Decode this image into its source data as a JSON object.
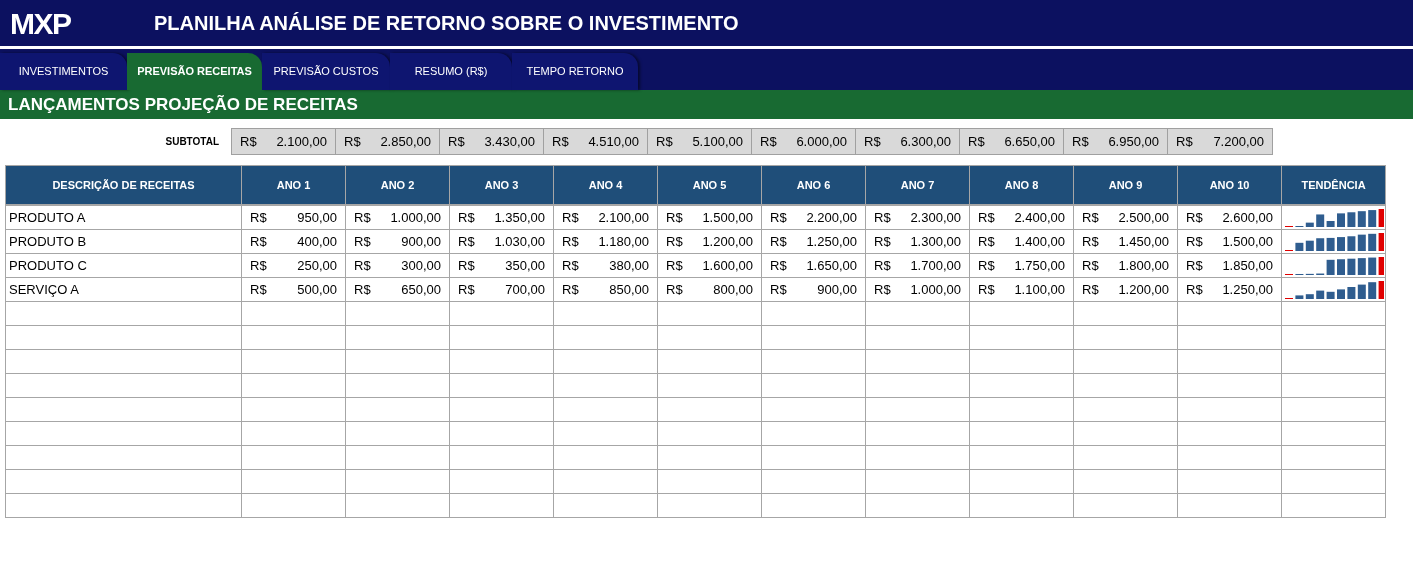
{
  "header": {
    "logo": "MXP",
    "title": "PLANILHA ANÁLISE DE RETORNO SOBRE O INVESTIMENTO"
  },
  "tabs": [
    {
      "label": "INVESTIMENTOS",
      "selected": false
    },
    {
      "label": "PREVISÃO RECEITAS",
      "selected": true
    },
    {
      "label": "PREVISÃO CUSTOS",
      "selected": false
    },
    {
      "label": "RESUMO (R$)",
      "selected": false
    },
    {
      "label": "TEMPO RETORNO",
      "selected": false
    }
  ],
  "section_title": "LANÇAMENTOS PROJEÇÃO DE RECEITAS",
  "subtotal": {
    "label": "SUBTOTAL",
    "values": [
      {
        "currency": "R$",
        "amount": "2.100,00"
      },
      {
        "currency": "R$",
        "amount": "2.850,00"
      },
      {
        "currency": "R$",
        "amount": "3.430,00"
      },
      {
        "currency": "R$",
        "amount": "4.510,00"
      },
      {
        "currency": "R$",
        "amount": "5.100,00"
      },
      {
        "currency": "R$",
        "amount": "6.000,00"
      },
      {
        "currency": "R$",
        "amount": "6.300,00"
      },
      {
        "currency": "R$",
        "amount": "6.650,00"
      },
      {
        "currency": "R$",
        "amount": "6.950,00"
      },
      {
        "currency": "R$",
        "amount": "7.200,00"
      }
    ]
  },
  "table": {
    "columns": [
      "DESCRIÇÃO DE RECEITAS",
      "ANO 1",
      "ANO 2",
      "ANO 3",
      "ANO 4",
      "ANO 5",
      "ANO 6",
      "ANO 7",
      "ANO 8",
      "ANO 9",
      "ANO 10",
      "TENDÊNCIA"
    ],
    "rows": [
      {
        "cells": [
          {
            "kind": "text",
            "text": "PRODUTO A"
          },
          {
            "kind": "money",
            "currency": "R$",
            "amount": "950,00"
          },
          {
            "kind": "money",
            "currency": "R$",
            "amount": "1.000,00"
          },
          {
            "kind": "money",
            "currency": "R$",
            "amount": "1.350,00"
          },
          {
            "kind": "money",
            "currency": "R$",
            "amount": "2.100,00"
          },
          {
            "kind": "money",
            "currency": "R$",
            "amount": "1.500,00"
          },
          {
            "kind": "money",
            "currency": "R$",
            "amount": "2.200,00"
          },
          {
            "kind": "money",
            "currency": "R$",
            "amount": "2.300,00"
          },
          {
            "kind": "money",
            "currency": "R$",
            "amount": "2.400,00"
          },
          {
            "kind": "money",
            "currency": "R$",
            "amount": "2.500,00"
          },
          {
            "kind": "money",
            "currency": "R$",
            "amount": "2.600,00"
          },
          {
            "kind": "sparkline"
          }
        ]
      },
      {
        "cells": [
          {
            "kind": "text",
            "text": "PRODUTO B"
          },
          {
            "kind": "money",
            "currency": "R$",
            "amount": "400,00"
          },
          {
            "kind": "money",
            "currency": "R$",
            "amount": "900,00"
          },
          {
            "kind": "money",
            "currency": "R$",
            "amount": "1.030,00"
          },
          {
            "kind": "money",
            "currency": "R$",
            "amount": "1.180,00"
          },
          {
            "kind": "money",
            "currency": "R$",
            "amount": "1.200,00"
          },
          {
            "kind": "money",
            "currency": "R$",
            "amount": "1.250,00"
          },
          {
            "kind": "money",
            "currency": "R$",
            "amount": "1.300,00"
          },
          {
            "kind": "money",
            "currency": "R$",
            "amount": "1.400,00"
          },
          {
            "kind": "money",
            "currency": "R$",
            "amount": "1.450,00"
          },
          {
            "kind": "money",
            "currency": "R$",
            "amount": "1.500,00"
          },
          {
            "kind": "sparkline"
          }
        ]
      },
      {
        "cells": [
          {
            "kind": "text",
            "text": "PRODUTO C"
          },
          {
            "kind": "money",
            "currency": "R$",
            "amount": "250,00"
          },
          {
            "kind": "money",
            "currency": "R$",
            "amount": "300,00"
          },
          {
            "kind": "money",
            "currency": "R$",
            "amount": "350,00"
          },
          {
            "kind": "money",
            "currency": "R$",
            "amount": "380,00"
          },
          {
            "kind": "money",
            "currency": "R$",
            "amount": "1.600,00"
          },
          {
            "kind": "money",
            "currency": "R$",
            "amount": "1.650,00"
          },
          {
            "kind": "money",
            "currency": "R$",
            "amount": "1.700,00"
          },
          {
            "kind": "money",
            "currency": "R$",
            "amount": "1.750,00"
          },
          {
            "kind": "money",
            "currency": "R$",
            "amount": "1.800,00"
          },
          {
            "kind": "money",
            "currency": "R$",
            "amount": "1.850,00"
          },
          {
            "kind": "sparkline"
          }
        ]
      },
      {
        "cells": [
          {
            "kind": "text",
            "text": "SERVIÇO A"
          },
          {
            "kind": "money",
            "currency": "R$",
            "amount": "500,00"
          },
          {
            "kind": "money",
            "currency": "R$",
            "amount": "650,00"
          },
          {
            "kind": "money",
            "currency": "R$",
            "amount": "700,00"
          },
          {
            "kind": "money",
            "currency": "R$",
            "amount": "850,00"
          },
          {
            "kind": "money",
            "currency": "R$",
            "amount": "800,00"
          },
          {
            "kind": "money",
            "currency": "R$",
            "amount": "900,00"
          },
          {
            "kind": "money",
            "currency": "R$",
            "amount": "1.000,00"
          },
          {
            "kind": "money",
            "currency": "R$",
            "amount": "1.100,00"
          },
          {
            "kind": "money",
            "currency": "R$",
            "amount": "1.200,00"
          },
          {
            "kind": "money",
            "currency": "R$",
            "amount": "1.250,00"
          },
          {
            "kind": "sparkline"
          }
        ]
      }
    ]
  }
}
